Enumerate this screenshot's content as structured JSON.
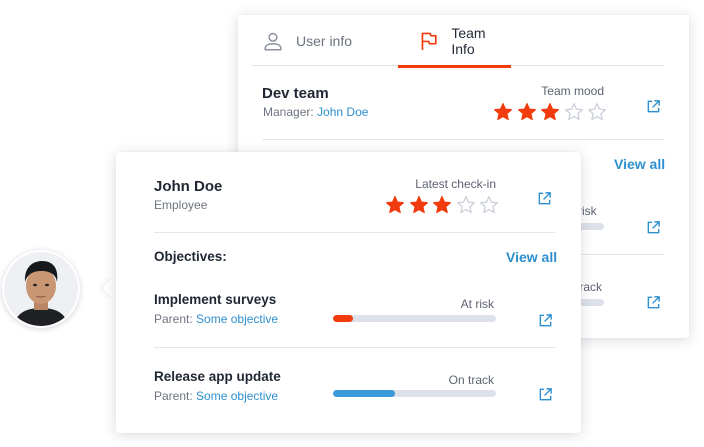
{
  "back_card": {
    "tabs": [
      {
        "label": "User info",
        "icon": "user-icon",
        "active": false
      },
      {
        "label": "Team Info",
        "icon": "flag-icon",
        "active": true
      }
    ],
    "team": {
      "name": "Dev team",
      "manager_label": "Manager:",
      "manager_name": "John Doe",
      "mood_label": "Team mood",
      "mood_rating": 3,
      "mood_max": 5
    },
    "view_all": "View all",
    "partial_row_1_status": "risk",
    "partial_row_2_status": "track"
  },
  "front_card": {
    "name": "John Doe",
    "role": "Employee",
    "checkin_label": "Latest check-in",
    "checkin_rating": 3,
    "checkin_max": 5,
    "objectives_label": "Objectives:",
    "view_all": "View all",
    "objectives": [
      {
        "title": "Implement surveys",
        "parent_label": "Parent:",
        "parent_link": "Some objective",
        "status": "At risk",
        "progress": 0.12,
        "color": "#f23b0c"
      },
      {
        "title": "Release app update",
        "parent_label": "Parent:",
        "parent_link": "Some objective",
        "status": "On track",
        "progress": 0.38,
        "color": "#3a9ad9"
      }
    ]
  },
  "colors": {
    "accent": "#f23b0c",
    "link": "#2e8fcf",
    "star_empty": "#c9ced8"
  }
}
